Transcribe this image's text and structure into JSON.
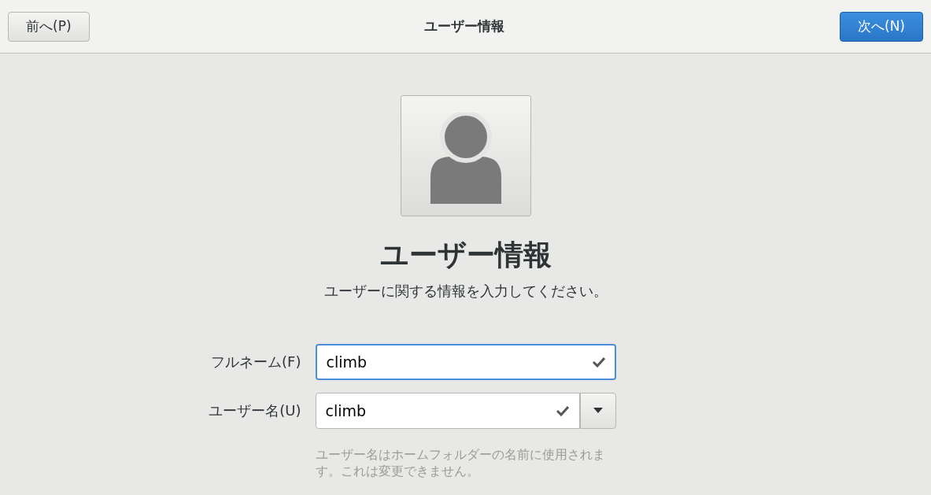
{
  "header": {
    "title": "ユーザー情報",
    "back_button": "前へ(P)",
    "next_button": "次へ(N)"
  },
  "page": {
    "title": "ユーザー情報",
    "subtitle": "ユーザーに関する情報を入力してください。"
  },
  "fields": [
    {
      "kind": "text",
      "label": "フルネーム(F)",
      "value": "climb",
      "focused": true,
      "valid": true
    },
    {
      "kind": "combo",
      "label": "ユーザー名(U)",
      "value": "climb",
      "focused": false,
      "valid": true,
      "hint": "ユーザー名はホームフォルダーの名前に使用されます。これは変更できません。"
    }
  ]
}
